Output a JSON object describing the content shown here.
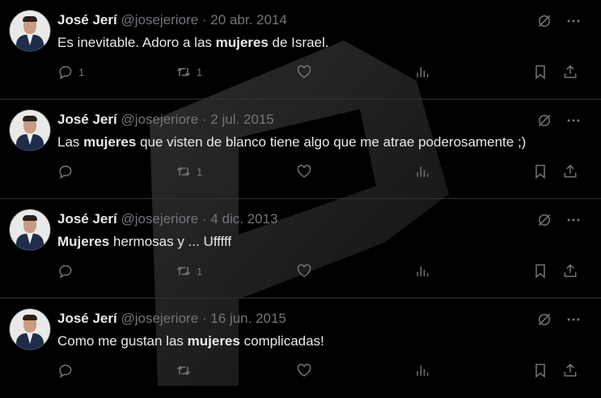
{
  "icons": {
    "reply": "reply-icon",
    "retweet": "retweet-icon",
    "like": "like-icon",
    "views": "views-icon",
    "bookmark": "bookmark-icon",
    "share": "share-icon",
    "grok": "grok-icon",
    "more": "more-icon"
  },
  "colors": {
    "background": "#000000",
    "text": "#e7e9ea",
    "muted": "#71767b",
    "divider": "#2f3336"
  },
  "tweets": [
    {
      "name": "José Jerí",
      "handle": "@josejeriore",
      "sep": "·",
      "date": "20 abr. 2014",
      "text_a": "Es inevitable. Adoro a las ",
      "text_b": "mujeres",
      "text_c": " de Israel.",
      "replies": "1",
      "retweets": "1"
    },
    {
      "name": "José Jerí",
      "handle": "@josejeriore",
      "sep": "·",
      "date": "2 jul. 2015",
      "text_a": "Las ",
      "text_b": "mujeres",
      "text_c": " que visten de blanco tiene algo que me atrae poderosamente ;)",
      "replies": "",
      "retweets": "1"
    },
    {
      "name": "José Jerí",
      "handle": "@josejeriore",
      "sep": "·",
      "date": "4 dic. 2013",
      "text_a": "",
      "text_b": "Mujeres",
      "text_c": " hermosas y ... Ufffff",
      "replies": "",
      "retweets": "1"
    },
    {
      "name": "José Jerí",
      "handle": "@josejeriore",
      "sep": "·",
      "date": "16 jun. 2015",
      "text_a": "Como me gustan las ",
      "text_b": "mujeres",
      "text_c": " complicadas!",
      "replies": "",
      "retweets": ""
    }
  ]
}
